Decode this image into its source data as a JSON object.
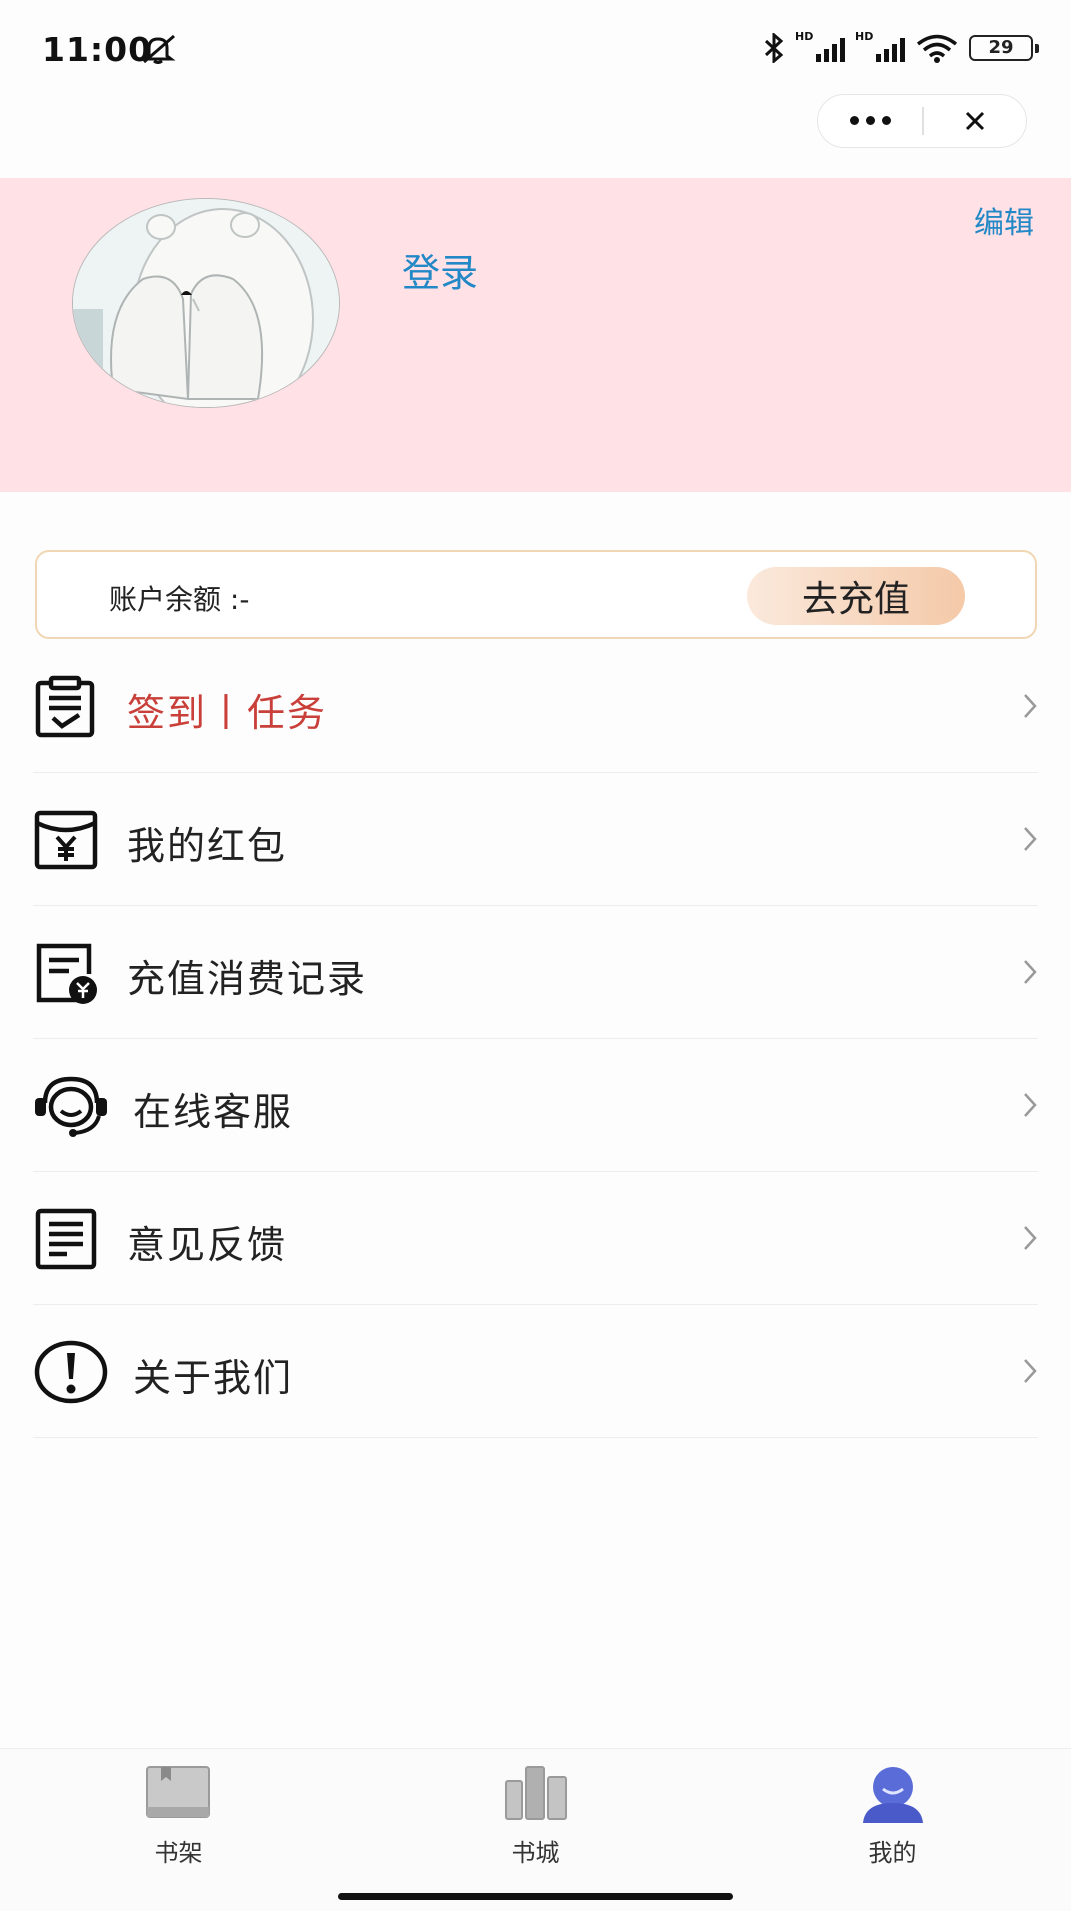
{
  "status_bar": {
    "time": "11:00",
    "battery": "29",
    "hd1": "HD",
    "hd2": "HD"
  },
  "header": {
    "login": "登录",
    "edit": "编辑"
  },
  "balance": {
    "label": "账户余额 :-",
    "button": "去充值"
  },
  "menu": [
    {
      "label": "签到丨任务",
      "icon": "clipboard-check-icon",
      "color": "#c9403a"
    },
    {
      "label": "我的红包",
      "icon": "red-envelope-icon"
    },
    {
      "label": "充值消费记录",
      "icon": "bill-record-icon"
    },
    {
      "label": "在线客服",
      "icon": "customer-service-icon"
    },
    {
      "label": "意见反馈",
      "icon": "feedback-document-icon"
    },
    {
      "label": "关于我们",
      "icon": "exclamation-circle-icon"
    }
  ],
  "tabs": [
    {
      "label": "书架",
      "icon": "bookshelf-icon"
    },
    {
      "label": "书城",
      "icon": "bookstore-icon"
    },
    {
      "label": "我的",
      "icon": "profile-icon",
      "active": true
    }
  ],
  "colors": {
    "header_bg": "#ffe1e6",
    "link": "#2389c6",
    "accent_red": "#c9403a",
    "active_tab": "#5a6cd8"
  }
}
